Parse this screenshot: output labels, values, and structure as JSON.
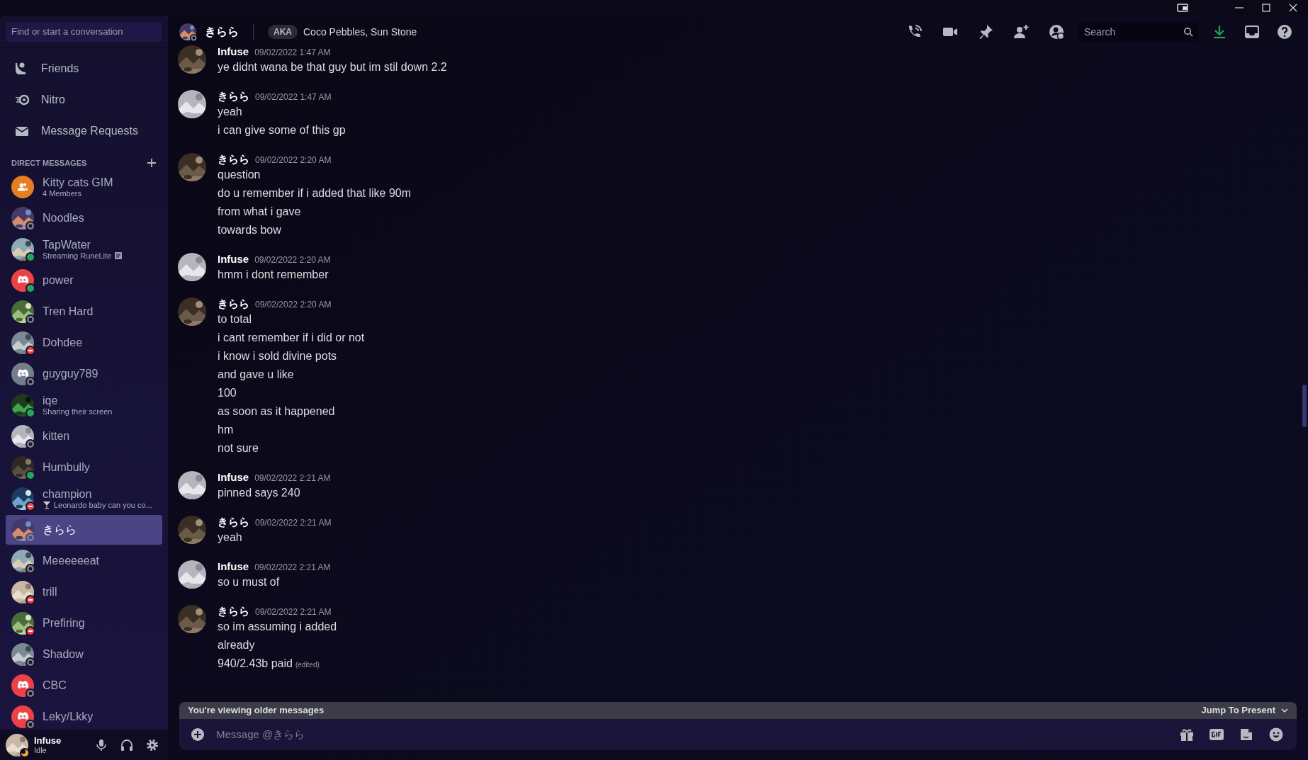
{
  "window": {
    "controls": [
      {
        "kind": "snap"
      },
      {
        "kind": "minimize"
      },
      {
        "kind": "maximize"
      },
      {
        "kind": "close"
      }
    ]
  },
  "sidebar": {
    "search": {
      "placeholder": "Find or start a conversation"
    },
    "nav": [
      {
        "label": "Friends",
        "kind": "friends"
      },
      {
        "label": "Nitro",
        "kind": "nitro"
      },
      {
        "label": "Message Requests",
        "kind": "requests"
      }
    ],
    "dm_heading": "DIRECT MESSAGES",
    "dms": [
      {
        "name": "Kitty cats GIM",
        "subtitle": "4 Members",
        "avatar": {
          "kind": "group",
          "color": "#e67e22"
        },
        "selected": false
      },
      {
        "name": "Noodles",
        "status": {
          "kind": "offline"
        },
        "selected": false
      },
      {
        "name": "TapWater",
        "subtitle": "Streaming RuneLite",
        "subtitle_icon": {
          "kind": "document"
        },
        "status": {
          "kind": "online"
        },
        "selected": false
      },
      {
        "name": "power",
        "avatar": {
          "kind": "default",
          "color": "#ed4245"
        },
        "status": {
          "kind": "online"
        },
        "selected": false
      },
      {
        "name": "Tren Hard",
        "status": {
          "kind": "offline"
        },
        "selected": false
      },
      {
        "name": "Dohdee",
        "status": {
          "kind": "dnd"
        },
        "selected": false
      },
      {
        "name": "guyguy789",
        "avatar": {
          "kind": "default",
          "color": "#747f8d"
        },
        "status": {
          "kind": "offline"
        },
        "selected": false
      },
      {
        "name": "iqe",
        "subtitle": "Sharing their screen",
        "status": {
          "kind": "online"
        },
        "selected": false
      },
      {
        "name": "kitten",
        "status": {
          "kind": "offline"
        },
        "selected": false
      },
      {
        "name": "Humbully",
        "status": {
          "kind": "online"
        },
        "selected": false
      },
      {
        "name": "champion",
        "subtitle": "Leonardo baby can you co...",
        "subtitle_icon": {
          "kind": "cocktail"
        },
        "status": {
          "kind": "dnd"
        },
        "selected": false
      },
      {
        "name": "きらら",
        "status": {
          "kind": "offline"
        },
        "selected": true
      },
      {
        "name": "Meeeeeeat",
        "status": {
          "kind": "offline"
        },
        "selected": false
      },
      {
        "name": "trill",
        "status": {
          "kind": "dnd"
        },
        "selected": false
      },
      {
        "name": "Prefiring",
        "status": {
          "kind": "dnd"
        },
        "selected": false
      },
      {
        "name": "Shadow",
        "status": {
          "kind": "offline"
        },
        "selected": false
      },
      {
        "name": "CBC",
        "avatar": {
          "kind": "default",
          "color": "#ed4245"
        },
        "status": {
          "kind": "offline"
        },
        "selected": false
      },
      {
        "name": "Leky/Lkky",
        "avatar": {
          "kind": "default",
          "color": "#ed4245"
        },
        "status": {
          "kind": "offline"
        },
        "selected": false
      }
    ],
    "user_panel": {
      "name": "Infuse",
      "status_text": "Idle",
      "status": {
        "kind": "idle"
      }
    }
  },
  "header": {
    "name": "きらら",
    "status": {
      "kind": "offline"
    },
    "aka_badge": "AKA",
    "aka": "Coco Pebbles, Sun Stone",
    "search": {
      "placeholder": "Search"
    }
  },
  "messages": [
    {
      "author": "Infuse",
      "time": "09/02/2022 1:47 AM",
      "lines": [
        "ye didnt wana be that guy but im stil down 2.2"
      ]
    },
    {
      "author": "きらら",
      "time": "09/02/2022 1:47 AM",
      "lines": [
        "yeah",
        "i can give some of this gp"
      ]
    },
    {
      "author": "きらら",
      "time": "09/02/2022 2:20 AM",
      "lines": [
        "question",
        "do u remember if i added that like 90m",
        "from what i gave",
        "towards bow"
      ]
    },
    {
      "author": "Infuse",
      "time": "09/02/2022 2:20 AM",
      "lines": [
        "hmm i dont remember"
      ]
    },
    {
      "author": "きらら",
      "time": "09/02/2022 2:20 AM",
      "lines": [
        "to total",
        "i cant remember if i did or not",
        "i know i sold divine pots",
        "and gave u like",
        "100",
        "as soon as it happened",
        "hm",
        "not sure"
      ]
    },
    {
      "author": "Infuse",
      "time": "09/02/2022 2:21 AM",
      "lines": [
        "pinned says 240"
      ]
    },
    {
      "author": "きらら",
      "time": "09/02/2022 2:21 AM",
      "lines": [
        "yeah"
      ]
    },
    {
      "author": "Infuse",
      "time": "09/02/2022 2:21 AM",
      "lines": [
        "so u must of"
      ]
    },
    {
      "author": "きらら",
      "time": "09/02/2022 2:21 AM",
      "lines": [
        "so im assuming i added",
        "already",
        "940/2.43b paid"
      ],
      "edited_label": "(edited)"
    }
  ],
  "older_bar": {
    "text": "You're viewing older messages",
    "jump": "Jump To Present"
  },
  "composer": {
    "placeholder": "Message @きらら"
  }
}
